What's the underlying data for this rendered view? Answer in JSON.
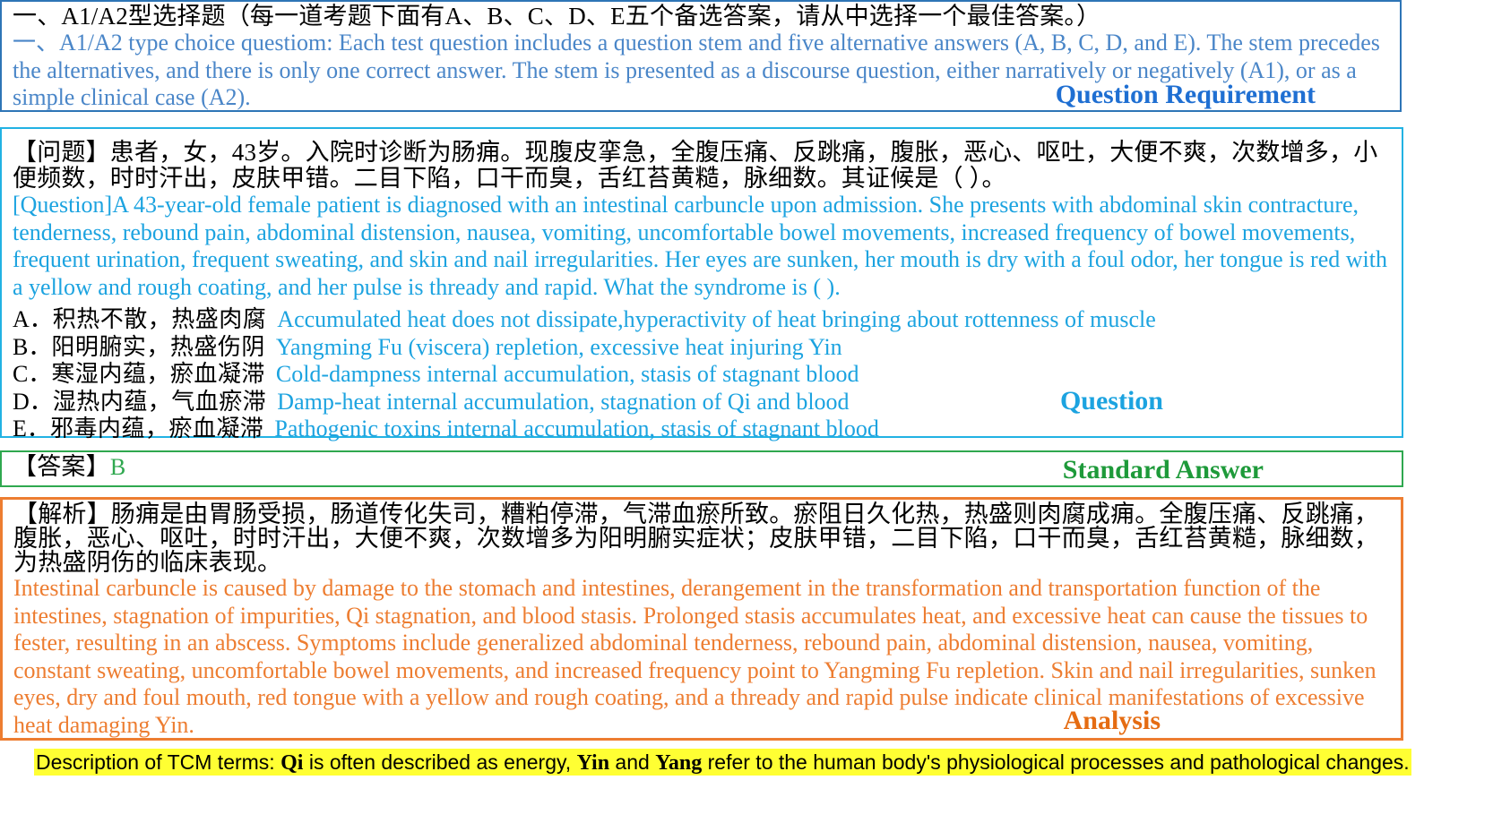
{
  "requirement": {
    "zh": "一、A1/A2型选择题（每一道考题下面有A、B、C、D、E五个备选答案，请从中选择一个最佳答案。）",
    "en": "一、A1/A2 type choice questiom: Each test question includes a question stem and five alternative answers (A, B, C, D, and E). The stem precedes the alternatives, and there is only one correct answer. The stem is presented as a discourse question, either narratively or negatively (A1), or as a simple clinical case (A2).",
    "label": "Question Requirement"
  },
  "question": {
    "zh": "【问题】患者，女，43岁。入院时诊断为肠痈。现腹皮挛急，全腹压痛、反跳痛，腹胀，恶心、呕吐，大便不爽，次数增多，小便频数，时时汗出，皮肤甲错。二目下陷，口干而臭，舌红苔黄糙，脉细数。其证候是（ ）。",
    "en": "[Question]A 43-year-old female patient is diagnosed with an intestinal carbuncle upon admission. She presents with abdominal skin contracture, tenderness, rebound pain, abdominal distension, nausea, vomiting, uncomfortable bowel movements, increased frequency of bowel movements, frequent urination, frequent sweating, and skin and nail irregularities. Her eyes are sunken, her mouth is dry with a foul odor, her tongue is red with a yellow and rough coating, and her pulse is thready and rapid. What the syndrome is ( ).",
    "options": [
      {
        "key": "A．",
        "zh": "积热不散，热盛肉腐",
        "en": "Accumulated heat does not dissipate,hyperactivity of heat bringing about rottenness of muscle"
      },
      {
        "key": "B．",
        "zh": "阳明腑实，热盛伤阴",
        "en": "Yangming Fu (viscera) repletion, excessive heat injuring Yin"
      },
      {
        "key": "C．",
        "zh": "寒湿内蕴，瘀血凝滞",
        "en": "Cold-dampness internal accumulation, stasis of stagnant blood"
      },
      {
        "key": "D．",
        "zh": "湿热内蕴，气血瘀滞",
        "en": "Damp-heat internal accumulation, stagnation of Qi and blood"
      },
      {
        "key": "E．",
        "zh": "邪毒内蕴，瘀血凝滞",
        "en": "Pathogenic toxins internal accumulation, stasis of stagnant blood"
      }
    ],
    "label": "Question"
  },
  "answer": {
    "prefix": "【答案】",
    "value": "B",
    "label": "Standard Answer"
  },
  "analysis": {
    "zh": "【解析】肠痈是由胃肠受损，肠道传化失司，糟粕停滞，气滞血瘀所致。瘀阻日久化热，热盛则肉腐成痈。全腹压痛、反跳痛，腹胀，恶心、呕吐，时时汗出，大便不爽，次数增多为阳明腑实症状；皮肤甲错，二目下陷，口干而臭，舌红苔黄糙，脉细数，为热盛阴伤的临床表现。",
    "en": "Intestinal carbuncle is caused by damage to the stomach and intestines, derangement in the transformation and transportation function of the intestines, stagnation of impurities, Qi stagnation, and blood stasis. Prolonged stasis accumulates heat, and excessive heat can cause the tissues to fester, resulting in an abscess. Symptoms include generalized abdominal tenderness, rebound pain, abdominal distension, nausea, vomiting, constant sweating, uncomfortable bowel movements, and increased frequency point to Yangming Fu repletion. Skin and nail irregularities, sunken eyes, dry and foul mouth, red tongue with a yellow and rough coating, and a thready and rapid pulse indicate clinical manifestations of excessive heat damaging Yin.",
    "label": "Analysis"
  },
  "note": {
    "t1": "Description of TCM terms: ",
    "qi": "Qi",
    "t2": " is often described as energy, ",
    "yin": "Yin",
    "t3": " and ",
    "yang": "Yang",
    "t4": " refer to the human body's physiological processes and pathological changes."
  },
  "colors": {
    "requirement": "#2e75b6",
    "question": "#22b2e3",
    "answer": "#2fa84f",
    "analysis": "#ed7d31",
    "highlight": "#ffff33"
  }
}
